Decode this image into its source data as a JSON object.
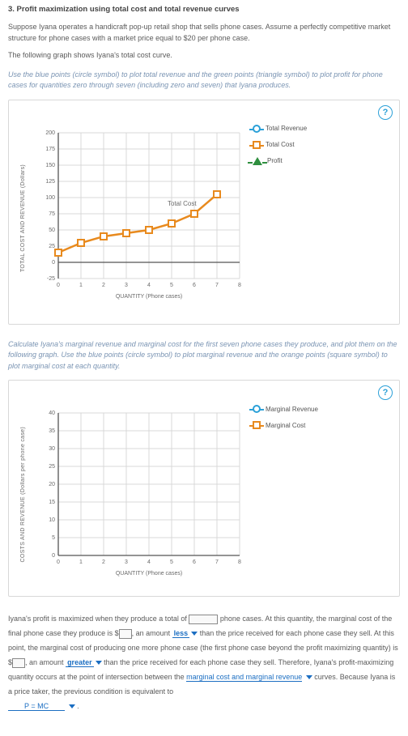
{
  "title": "3. Profit maximization using total cost and total revenue curves",
  "intro1": "Suppose Iyana operates a handicraft pop-up retail shop that sells phone cases. Assume a perfectly competitive market structure for phone cases with a market price equal to $20 per phone case.",
  "intro2": "The following graph shows Iyana's total cost curve.",
  "instr1": "Use the blue points (circle symbol) to plot total revenue and the green points (triangle symbol) to plot profit for phone cases for quantities zero through seven (including zero and seven) that Iyana produces.",
  "help": "?",
  "chart_data": [
    {
      "type": "line",
      "title": "",
      "xlabel": "QUANTITY (Phone cases)",
      "ylabel": "TOTAL COST AND REVENUE (Dollars)",
      "xticks": [
        0,
        1,
        2,
        3,
        4,
        5,
        6,
        7,
        8
      ],
      "yticks": [
        -25,
        0,
        25,
        50,
        75,
        100,
        125,
        150,
        175,
        200
      ],
      "ylim": [
        -25,
        200
      ],
      "xlim": [
        0,
        8
      ],
      "series": [
        {
          "name": "Total Cost",
          "color": "#e88a1e",
          "marker": "square",
          "x": [
            0,
            1,
            2,
            3,
            4,
            5,
            6,
            7
          ],
          "y": [
            15,
            30,
            40,
            45,
            50,
            60,
            75,
            105
          ]
        }
      ],
      "legend_tools": [
        "Total Revenue",
        "Total Cost",
        "Profit"
      ]
    },
    {
      "type": "line",
      "title": "",
      "xlabel": "QUANTITY (Phone cases)",
      "ylabel": "COSTS AND REVENUE (Dollars per phone case)",
      "xticks": [
        0,
        1,
        2,
        3,
        4,
        5,
        6,
        7,
        8
      ],
      "yticks": [
        0,
        5,
        10,
        15,
        20,
        25,
        30,
        35,
        40
      ],
      "ylim": [
        0,
        40
      ],
      "xlim": [
        0,
        8
      ],
      "series": [],
      "legend_tools": [
        "Marginal Revenue",
        "Marginal Cost"
      ]
    }
  ],
  "legend1": {
    "tr": "Total Revenue",
    "tc": "Total Cost",
    "pr": "Profit"
  },
  "instr2": "Calculate Iyana's marginal revenue and marginal cost for the first seven phone cases they produce, and plot them on the following graph. Use the blue points (circle symbol) to plot marginal revenue and the orange points (square symbol) to plot marginal cost at each quantity.",
  "legend2": {
    "mr": "Marginal Revenue",
    "mc": "Marginal Cost"
  },
  "fill": {
    "t1": "Iyana's profit is maximized when they produce a total of ",
    "t2": " phone cases. At this quantity, the marginal cost of the final phone case they produce is ",
    "t3": ", an amount ",
    "dd1": "less",
    "t4": " than the price received for each phone case they sell. At this point, the marginal cost of producing one more phone case (the first phone case beyond the profit maximizing quantity) is ",
    "t5": ", an amount ",
    "dd2": "greater",
    "t6": " than the price received for each phone case they sell. Therefore, Iyana's profit-maximizing quantity occurs at the point of intersection between the ",
    "dd3": "marginal cost and marginal revenue",
    "t7": " curves. Because Iyana is a price taker, the previous condition is equivalent to ",
    "dd4": "P = MC",
    "t8": " ."
  }
}
